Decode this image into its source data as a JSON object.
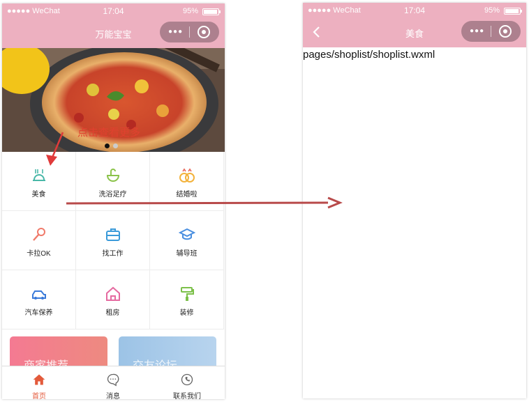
{
  "left_phone": {
    "status_bar": {
      "carrier": "●●●●● WeChat",
      "time": "17:04",
      "battery": "95%"
    },
    "nav_title": "万能宝宝",
    "banner": {
      "caption": "点击查看更多",
      "active_slide": 1,
      "slide_count": 2
    },
    "grid": [
      {
        "label": "美食",
        "icon": "food-icon"
      },
      {
        "label": "洗浴足疗",
        "icon": "bath-icon"
      },
      {
        "label": "结婚啦",
        "icon": "rings-icon"
      },
      {
        "label": "卡拉OK",
        "icon": "microphone-icon"
      },
      {
        "label": "找工作",
        "icon": "briefcase-icon"
      },
      {
        "label": "辅导班",
        "icon": "graduation-cap-icon"
      },
      {
        "label": "汽车保养",
        "icon": "car-icon"
      },
      {
        "label": "租房",
        "icon": "house-icon"
      },
      {
        "label": "装修",
        "icon": "paint-roller-icon"
      }
    ],
    "cards": [
      {
        "label": "商家推荐",
        "color": "#ee7a86"
      },
      {
        "label": "交友论坛",
        "color": "#9cc3e6"
      }
    ],
    "tabbar": [
      {
        "label": "首页",
        "icon": "home-icon",
        "active": true
      },
      {
        "label": "消息",
        "icon": "message-icon",
        "active": false
      },
      {
        "label": "联系我们",
        "icon": "phone-icon",
        "active": false
      }
    ]
  },
  "right_phone": {
    "status_bar": {
      "carrier": "●●●●● WeChat",
      "time": "17:04",
      "battery": "95%"
    },
    "nav_title": "美食",
    "content_text": "pages/shoplist/shoplist.wxml"
  },
  "colors": {
    "nav_pink": "#edb0c0",
    "tab_active": "#e35a3b",
    "arrow": "#b84a4a"
  }
}
